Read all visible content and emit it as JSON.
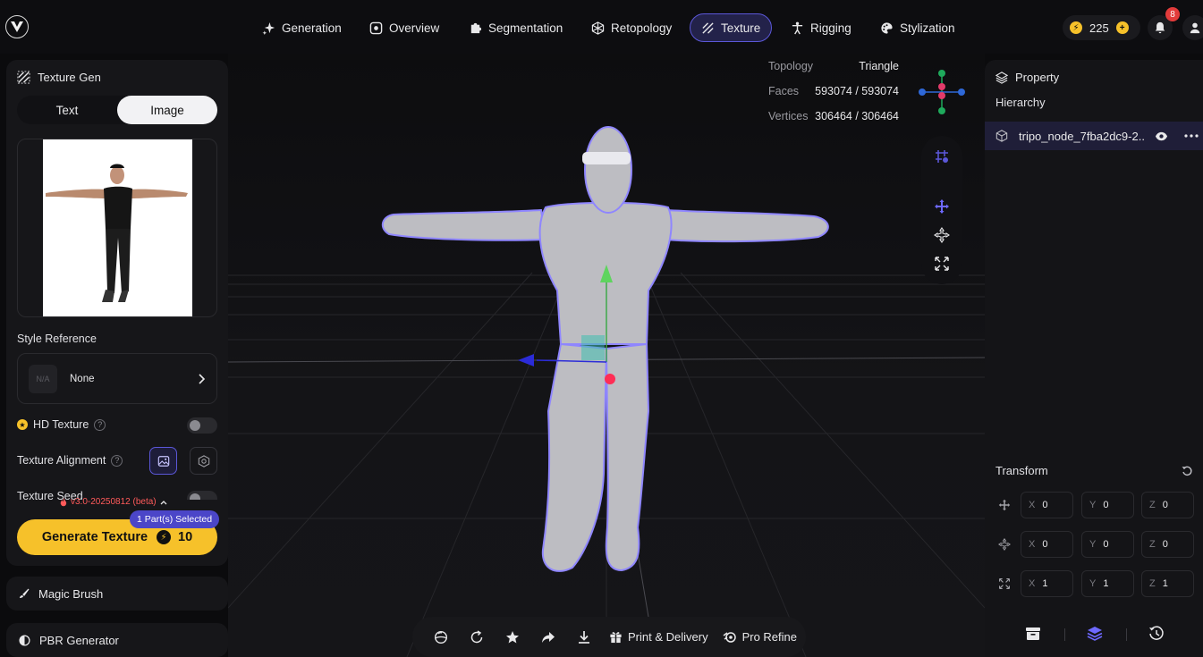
{
  "header": {
    "tabs": [
      {
        "label": "Generation",
        "icon": "sparkle-icon"
      },
      {
        "label": "Overview",
        "icon": "overview-icon"
      },
      {
        "label": "Segmentation",
        "icon": "puzzle-icon"
      },
      {
        "label": "Retopology",
        "icon": "mesh-icon"
      },
      {
        "label": "Texture",
        "icon": "texture-icon",
        "active": true
      },
      {
        "label": "Rigging",
        "icon": "figure-icon"
      },
      {
        "label": "Stylization",
        "icon": "palette-icon"
      }
    ],
    "credits": "225",
    "notifications": "8"
  },
  "left_panel": {
    "title": "Texture Gen",
    "mode_text": "Text",
    "mode_image": "Image",
    "style_reference_label": "Style Reference",
    "style_placeholder": "N/A",
    "style_value": "None",
    "hd_texture_label": "HD Texture",
    "hd_texture_on": false,
    "texture_alignment_label": "Texture Alignment",
    "texture_seed_label": "Texture Seed",
    "version": "v3.0-20250812 (beta)",
    "parts_selected": "1 Part(s) Selected",
    "generate_label": "Generate Texture",
    "generate_cost": "10",
    "magic_brush": "Magic Brush",
    "pbr_generator": "PBR Generator"
  },
  "viewport": {
    "topology_label": "Topology",
    "topology_value": "Triangle",
    "faces_label": "Faces",
    "faces_value": "593074 / 593074",
    "vertices_label": "Vertices",
    "vertices_value": "306464 / 306464"
  },
  "right_panel": {
    "property_label": "Property",
    "hierarchy_label": "Hierarchy",
    "node_name": "tripo_node_7fba2dc9-2...",
    "transform_label": "Transform",
    "position": {
      "x": "0",
      "y": "0",
      "z": "0"
    },
    "rotation": {
      "x": "0",
      "y": "0",
      "z": "0"
    },
    "scale": {
      "x": "1",
      "y": "1",
      "z": "1"
    },
    "axis_x": "X",
    "axis_y": "Y",
    "axis_z": "Z"
  },
  "bottom_bar": {
    "print_delivery": "Print & Delivery",
    "pro_refine": "Pro Refine"
  },
  "colors": {
    "accent": "#5b57d8",
    "gold": "#f6c12a",
    "badge_red": "#e23b3b"
  }
}
